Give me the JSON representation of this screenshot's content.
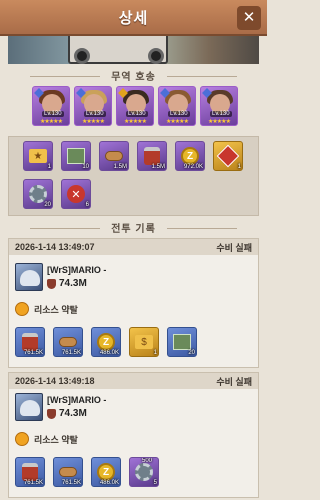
{
  "header": {
    "title": "상세",
    "close_icon": "close-icon"
  },
  "escort": {
    "title": "무역 호송",
    "heroes": [
      {
        "level": "Lv.130",
        "stars": "★★★★★"
      },
      {
        "level": "Lv.130",
        "stars": "★★★★★"
      },
      {
        "level": "Lv.130",
        "stars": "★★★★★"
      },
      {
        "level": "Lv.130",
        "stars": "★★★★★"
      },
      {
        "level": "Lv.130",
        "stars": "★★★★★"
      }
    ]
  },
  "cargo": {
    "items": [
      {
        "icon": "star-chest-icon",
        "qty": "1",
        "color": "purple"
      },
      {
        "icon": "gear-crate-icon",
        "qty": "10",
        "color": "purple"
      },
      {
        "icon": "wood-icon",
        "qty": "1.5M",
        "color": "purple"
      },
      {
        "icon": "food-can-icon",
        "qty": "1.5M",
        "color": "purple"
      },
      {
        "icon": "coin-icon",
        "qty": "972.0K",
        "color": "purple"
      },
      {
        "icon": "red-gem-icon",
        "qty": "1",
        "color": "gold"
      },
      {
        "icon": "gear-crate-icon",
        "qty": "20",
        "color": "purple"
      },
      {
        "icon": "red-badge-icon",
        "qty": "6",
        "color": "purple"
      }
    ]
  },
  "battle": {
    "title": "전투 기록",
    "records": [
      {
        "date": "2026-1-14 13:49:07",
        "result": "수비 실패",
        "attacker_name": "[WrS]MARIO -",
        "attacker_power": "74.3M",
        "loot_label": "리소스 약탈",
        "items": [
          {
            "icon": "food-can-icon",
            "qty": "761.5K",
            "color": "blue"
          },
          {
            "icon": "wood-icon",
            "qty": "761.5K",
            "color": "blue"
          },
          {
            "icon": "coin-icon",
            "qty": "486.0K",
            "color": "blue"
          },
          {
            "icon": "ticket-icon",
            "qty": "1",
            "color": "gold"
          },
          {
            "icon": "gear-crate-icon",
            "qty": "20",
            "color": "blue"
          }
        ]
      },
      {
        "date": "2026-1-14 13:49:18",
        "result": "수비 실패",
        "attacker_name": "[WrS]MARIO -",
        "attacker_power": "74.3M",
        "loot_label": "리소스 약탈",
        "items": [
          {
            "icon": "food-can-icon",
            "qty": "761.5K",
            "color": "blue"
          },
          {
            "icon": "wood-icon",
            "qty": "761.5K",
            "color": "blue"
          },
          {
            "icon": "coin-icon",
            "qty": "486.0K",
            "color": "blue"
          },
          {
            "icon": "gear-token-icon",
            "qty": "5",
            "color": "purple",
            "badge": "500"
          }
        ]
      }
    ]
  }
}
